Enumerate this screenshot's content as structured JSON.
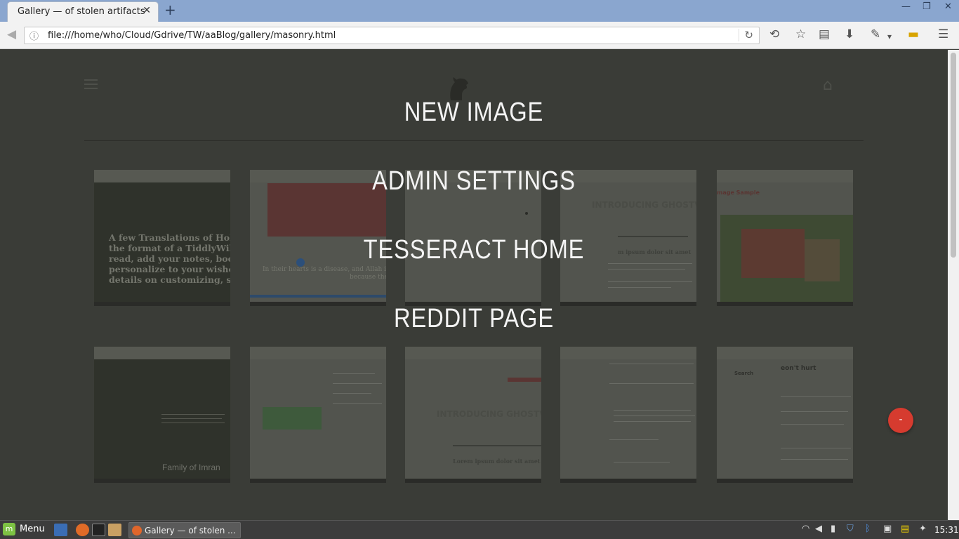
{
  "browser": {
    "tab_title": "Gallery — of stolen artifacts",
    "tab_close": "✕",
    "new_tab": "+",
    "url": "file:///home/who/Cloud/Gdrive/TW/aaBlog/gallery/masonry.html",
    "window_controls": [
      "—",
      "❐",
      "✕"
    ]
  },
  "overlay_menu": {
    "items": [
      "NEW IMAGE",
      "ADMIN SETTINGS",
      "TESSERACT HOME",
      "REDDIT PAGE"
    ]
  },
  "gallery": {
    "thumb_texts": {
      "t1": [
        "A few Translations of Holy",
        "the format of a TiddlyWiki",
        "read, add your notes, book",
        "personalize to your wishes",
        "details on customizing, see"
      ],
      "t2_caption": [
        "In their hearts is a disease, and Allah increaseth th",
        "because they li"
      ],
      "t4_heading": "INTRODUCING GHOSTV",
      "t4_sub": "m ipsum dolor sit amet",
      "t5_heading": "mage Sample",
      "t7_caption": "Family of Imran",
      "t9_heading": "INTRODUCING GHOSTV",
      "t9_sub": "Lorem ipsum dolor sit amet",
      "t11_search": "Search",
      "t11_heading": "eon't hurt"
    }
  },
  "fab_label": "-",
  "taskbar": {
    "menu_label": "Menu",
    "window_title": "Gallery — of stolen ...",
    "clock": "15:31"
  }
}
